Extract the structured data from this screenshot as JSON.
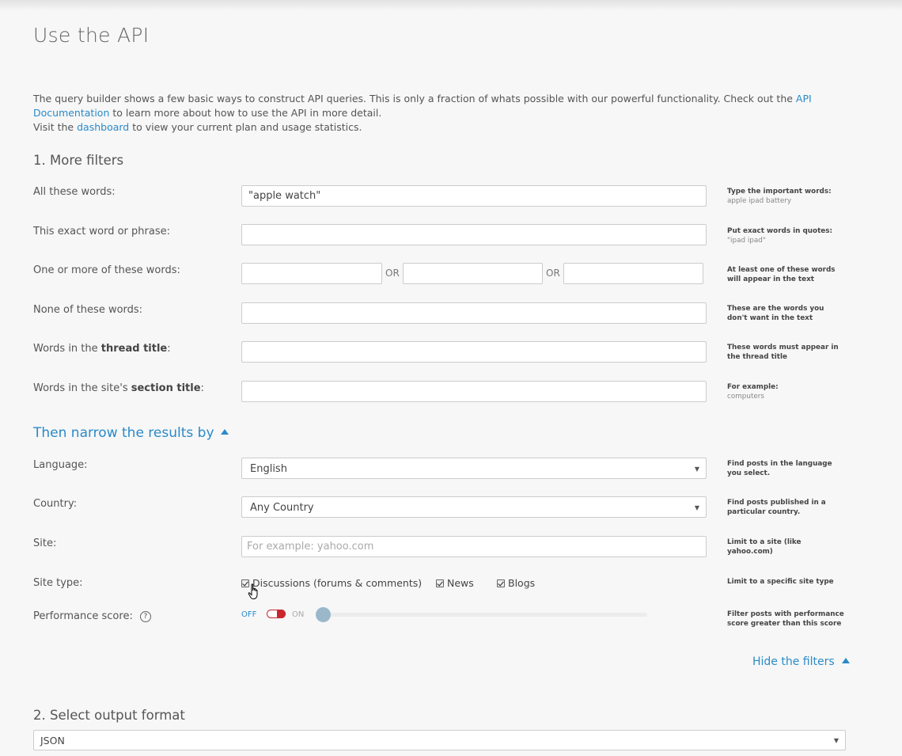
{
  "page": {
    "title": "Use the API"
  },
  "intro": {
    "line1_before": "The query builder shows a few basic ways to construct API queries. This is only a fraction of whats possible with our powerful functionality. Check out the ",
    "api_docs_link": "API Documentation",
    "line1_after": " to learn more about how to use the API in more detail.",
    "line2_before": "Visit the ",
    "dashboard_link": "dashboard",
    "line2_after": " to view your current plan and usage statistics."
  },
  "filters": {
    "section_title": "1. More filters",
    "all_words": {
      "label": "All these words:",
      "value": "\"apple watch\"",
      "hint_title": "Type the important words:",
      "hint_sub": "apple ipad battery"
    },
    "exact_phrase": {
      "label": "This exact word or phrase:",
      "value": "",
      "hint_title": "Put exact words in quotes:",
      "hint_sub": "\"ipad ipad\""
    },
    "any_words": {
      "label": "One or more of these words:",
      "or_label": "OR",
      "values": [
        "",
        "",
        ""
      ],
      "hint": "At least one of these words will appear in the text"
    },
    "none_words": {
      "label": "None of these words:",
      "value": "",
      "hint": "These are the words you don't want in the text"
    },
    "thread_title": {
      "label_prefix": "Words in the ",
      "label_bold": "thread title",
      "label_suffix": ":",
      "value": "",
      "hint": "These words must appear in the thread title"
    },
    "section_title_words": {
      "label_prefix": "Words in the site's ",
      "label_bold": "section title",
      "label_suffix": ":",
      "value": "",
      "hint_title": "For example:",
      "hint_sub": "computers"
    }
  },
  "narrow": {
    "toggle_label": "Then narrow the results by",
    "language": {
      "label": "Language:",
      "selected": "English",
      "hint": "Find posts in the language you select."
    },
    "country": {
      "label": "Country:",
      "selected": "Any Country",
      "hint": "Find posts published in a particular country."
    },
    "site": {
      "label": "Site:",
      "placeholder": "For example: yahoo.com",
      "value": "",
      "hint": "Limit to a site (like yahoo.com)"
    },
    "site_type": {
      "label": "Site type:",
      "options": [
        {
          "label": "Discussions (forums & comments)",
          "checked": true
        },
        {
          "label": "News",
          "checked": true
        },
        {
          "label": "Blogs",
          "checked": true
        }
      ],
      "hint": "Limit to a specific site type"
    },
    "performance": {
      "label": "Performance score:",
      "help_icon": "?",
      "off_label": "OFF",
      "on_label": "ON",
      "enabled": false,
      "score": 0,
      "hint": "Filter posts with performance score greater than this score"
    },
    "hide_filters": "Hide the filters"
  },
  "output": {
    "section_title": "2. Select output format",
    "selected": "JSON"
  },
  "colors": {
    "link": "#2a8ac8",
    "toggle_red": "#c8282d",
    "slider_handle": "#9bb8cb"
  }
}
